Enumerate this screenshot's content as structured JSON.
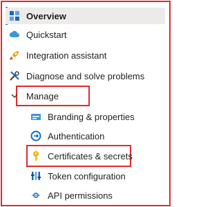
{
  "nav": {
    "overview": "Overview",
    "quickstart": "Quickstart",
    "integration": "Integration assistant",
    "diagnose": "Diagnose and solve problems",
    "manage": "Manage",
    "manage_items": {
      "branding": "Branding & properties",
      "authentication": "Authentication",
      "certificates": "Certificates & secrets",
      "token": "Token configuration",
      "api": "API permissions"
    }
  },
  "colors": {
    "highlight_border": "#e02a2a",
    "active_bg": "#edebe9",
    "active_bar": "#0f6cbd"
  }
}
